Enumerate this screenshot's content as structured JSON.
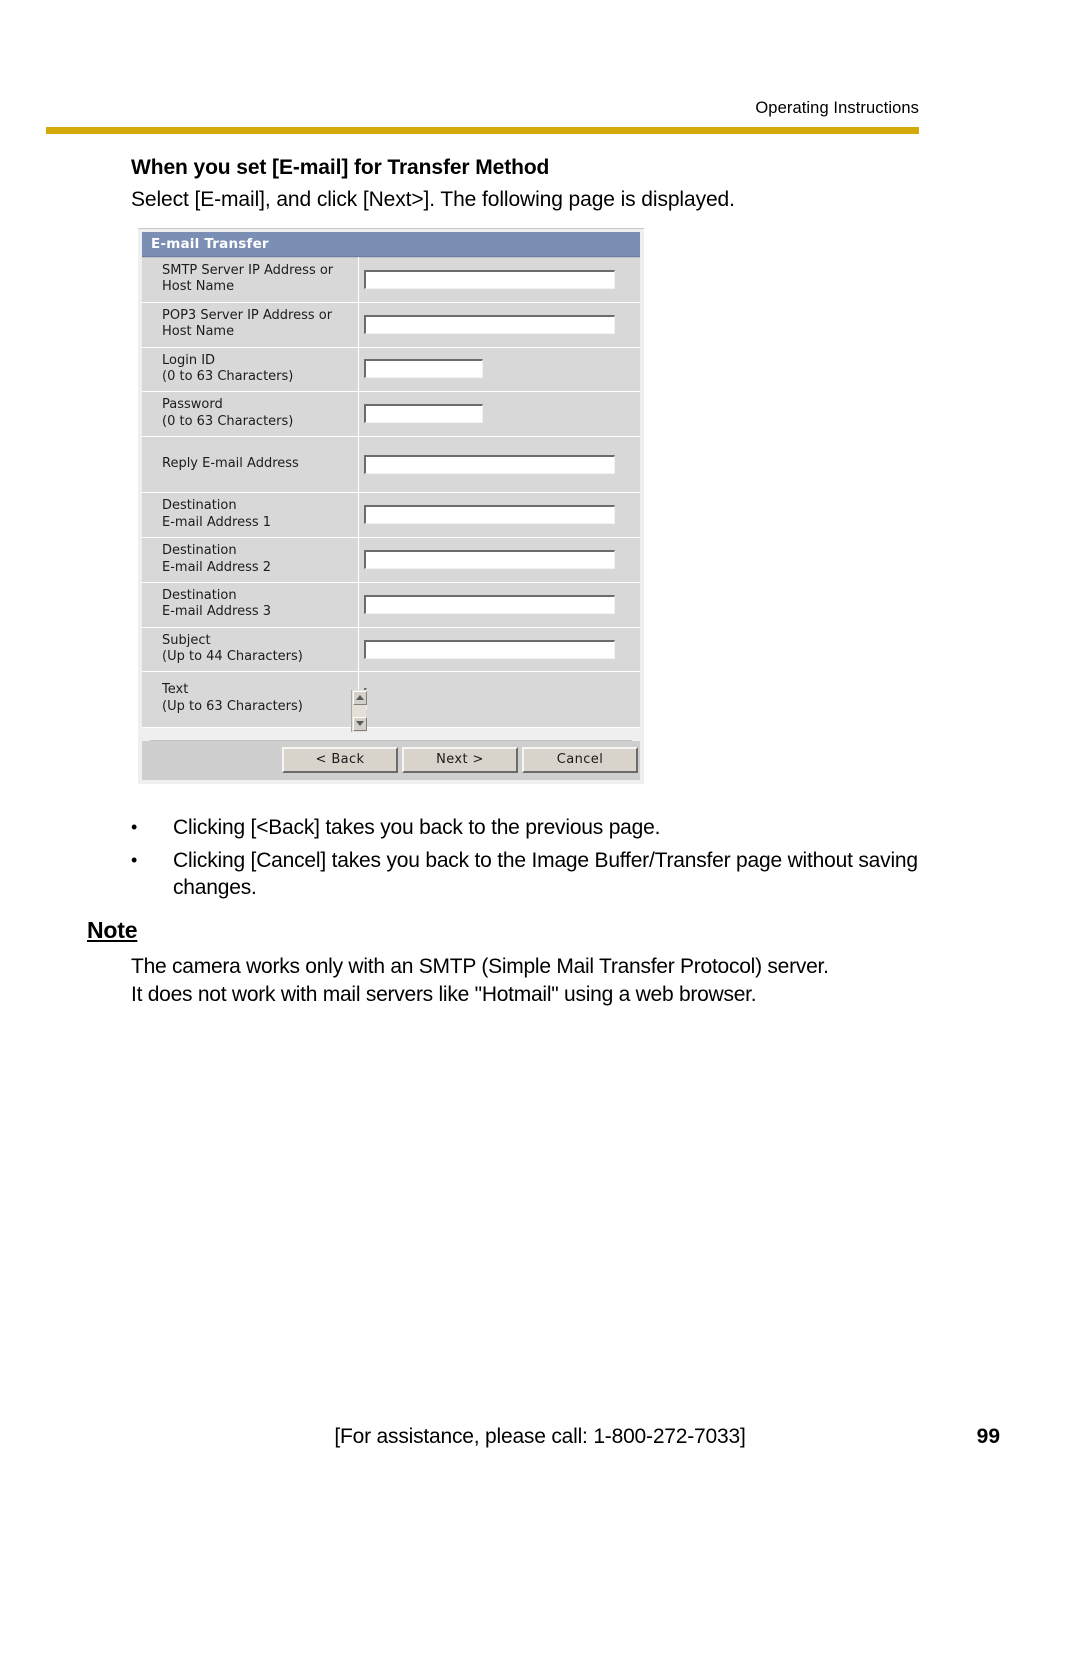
{
  "header": {
    "title": "Operating Instructions",
    "rule_color": "#d4a90a"
  },
  "section": {
    "heading": "When you set [E-mail] for Transfer Method",
    "intro": "Select [E-mail], and click [Next>]. The following page is displayed."
  },
  "figure": {
    "window_title": "E-mail Transfer",
    "title_bg": "#7b8fb5",
    "rows": [
      {
        "label": "SMTP Server IP Address or",
        "sublabel": "Host Name",
        "field": "wide",
        "value": ""
      },
      {
        "label": "POP3 Server IP Address or",
        "sublabel": "Host Name",
        "field": "wide",
        "value": ""
      },
      {
        "label": "Login ID",
        "sublabel": "(0 to 63 Characters)",
        "field": "short",
        "value": ""
      },
      {
        "label": "Password",
        "sublabel": "(0 to 63 Characters)",
        "field": "short",
        "value": ""
      },
      {
        "label": "Reply E-mail Address",
        "sublabel": "",
        "field": "wide",
        "value": ""
      },
      {
        "label": "Destination",
        "sublabel": "E-mail Address 1",
        "field": "wide",
        "value": ""
      },
      {
        "label": "Destination",
        "sublabel": "E-mail Address 2",
        "field": "wide",
        "value": ""
      },
      {
        "label": "Destination",
        "sublabel": "E-mail Address 3",
        "field": "wide",
        "value": ""
      },
      {
        "label": "Subject",
        "sublabel": "(Up to 44 Characters)",
        "field": "wide",
        "value": ""
      },
      {
        "label": "Text",
        "sublabel": "(Up to 63 Characters)",
        "field": "textarea",
        "value": ""
      }
    ],
    "buttons": {
      "back": "< Back",
      "next": "Next >",
      "cancel": "Cancel"
    }
  },
  "bullets": [
    {
      "marker": "•",
      "text": "Clicking [<Back] takes you back to the previous page."
    },
    {
      "marker": "•",
      "text": "Clicking [Cancel] takes you back to the Image Buffer/Transfer page without saving changes."
    }
  ],
  "note": {
    "heading": "Note",
    "line1": "The camera works only with an SMTP (Simple Mail Transfer Protocol) server.",
    "line2": "It does not work with mail servers like \"Hotmail\" using a web browser."
  },
  "footer": {
    "assistance": "[For assistance, please call: 1-800-272-7033]",
    "page_number": "99"
  }
}
